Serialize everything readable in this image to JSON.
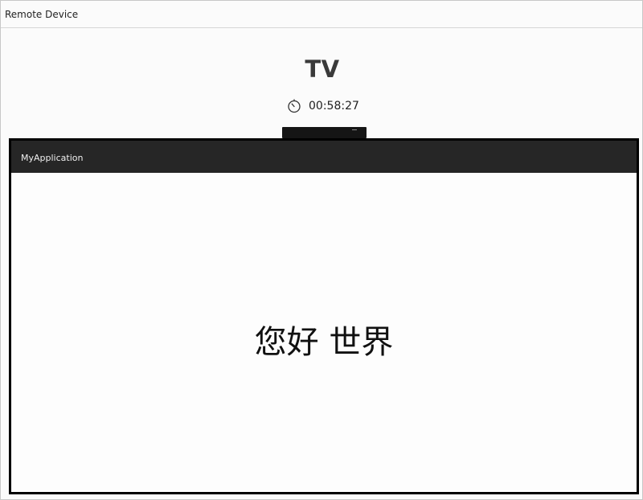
{
  "window": {
    "title": "Remote Device"
  },
  "device": {
    "name": "TV",
    "timer": "00:58:27",
    "timer_icon": "stopwatch-icon"
  },
  "app": {
    "title": "MyApplication",
    "content_text": "您好 世界"
  },
  "colors": {
    "app_bar": "#262626",
    "frame": "#000000",
    "background": "#fbfbfb"
  }
}
